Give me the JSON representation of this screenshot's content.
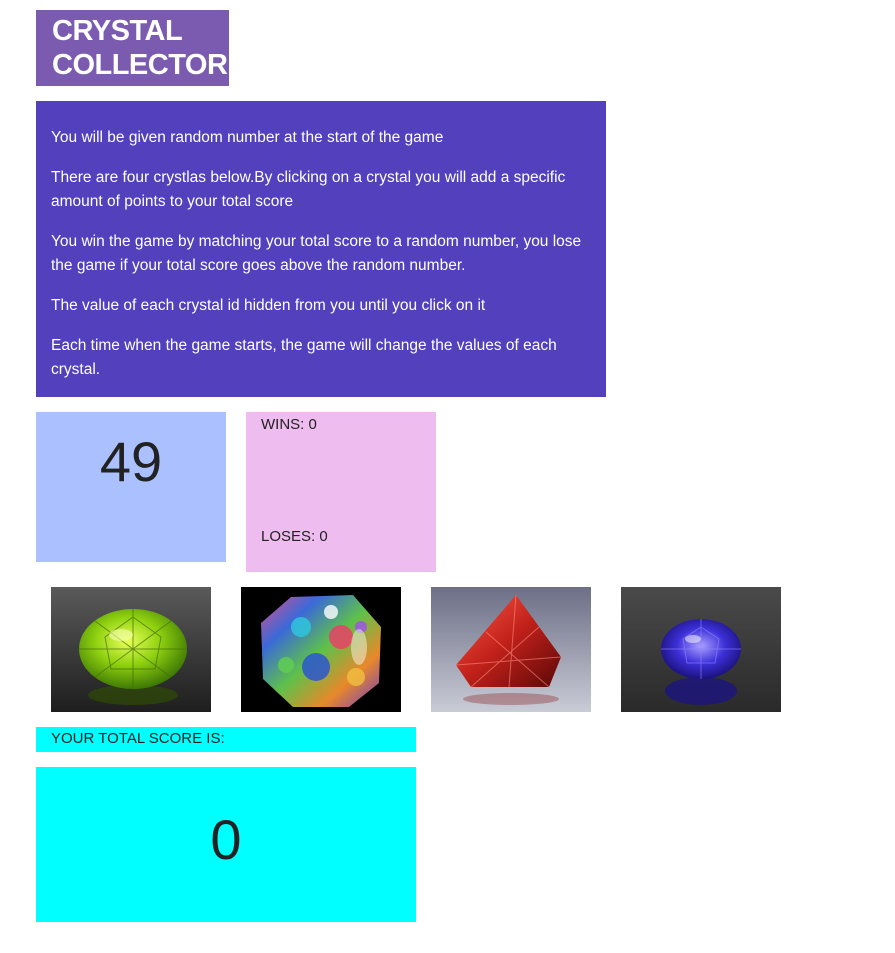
{
  "header": {
    "title": "CRYSTAL COLLECTOR!"
  },
  "instructions": {
    "paragraphs": [
      "You will be given random number at the start of the game",
      "There are four crystlas below.By clicking on a crystal you will add a specific amount of points to your total score",
      "You win the game by matching your total score to a random number, you lose the game if your total score goes above the random number.",
      "The value of each crystal id hidden from you until you click on it",
      "Each time when the game starts, the game will change the values of each crystal."
    ]
  },
  "target_number": "49",
  "stats": {
    "wins": "WINS: 0",
    "loses": "LOSES: 0"
  },
  "crystals": [
    {
      "name": "green-crystal-icon",
      "color": "#8fd10f"
    },
    {
      "name": "opal-crystal-icon",
      "color": "#3a6ad8"
    },
    {
      "name": "red-crystal-icon",
      "color": "#c0201a"
    },
    {
      "name": "blue-crystal-icon",
      "color": "#3c2fd8"
    }
  ],
  "total_score": {
    "label": "YOUR TOTAL SCORE IS:",
    "value": "0"
  },
  "colors": {
    "title_bg": "#7a5bb0",
    "instructions_bg": "#5240bd",
    "target_bg": "#aac0ff",
    "stats_bg": "#eebcee",
    "score_bg": "#00ffff"
  }
}
